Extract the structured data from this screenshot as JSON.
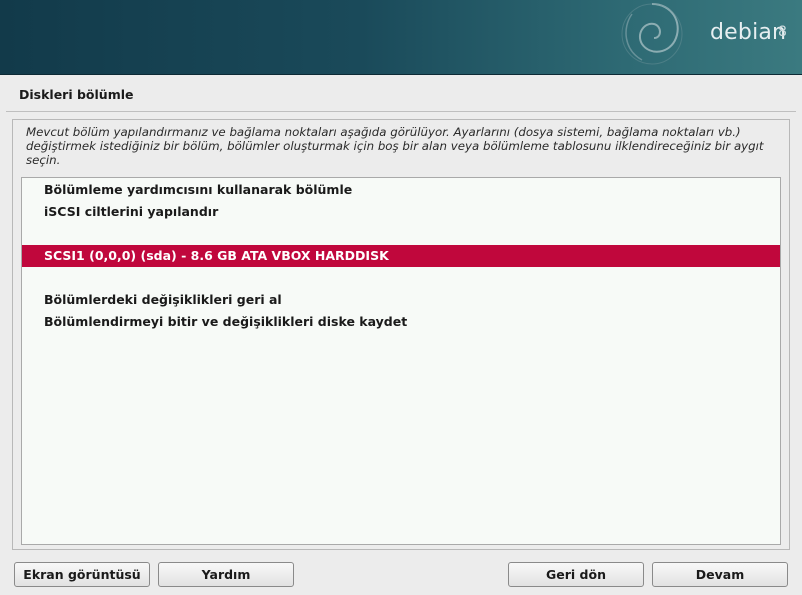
{
  "banner": {
    "brand": "debian",
    "version": "8"
  },
  "page": {
    "title": "Diskleri bölümle",
    "description": "Mevcut bölüm yapılandırmanız ve bağlama noktaları aşağıda görülüyor. Ayarlarını (dosya sistemi, bağlama noktaları vb.) değiştirmek istediğiniz bir bölüm, bölümler oluşturmak için boş bir alan veya bölümleme tablosunu ilklendireceğiniz bir aygıt seçin."
  },
  "list": {
    "items": [
      {
        "label": "Bölümleme yardımcısını kullanarak bölümle"
      },
      {
        "label": "iSCSI ciltlerini yapılandır"
      },
      {
        "label": ""
      },
      {
        "label": "SCSI1 (0,0,0) (sda) - 8.6 GB ATA VBOX HARDDISK"
      },
      {
        "label": ""
      },
      {
        "label": "Bölümlerdeki değişiklikleri geri al"
      },
      {
        "label": "Bölümlendirmeyi bitir ve değişiklikleri diske kaydet"
      }
    ],
    "selected_index": 3
  },
  "buttons": {
    "screenshot": "Ekran görüntüsü",
    "help": "Yardım",
    "back": "Geri dön",
    "continue": "Devam"
  },
  "colors": {
    "banner": "#1a4a5a",
    "selection": "#c0073c"
  }
}
